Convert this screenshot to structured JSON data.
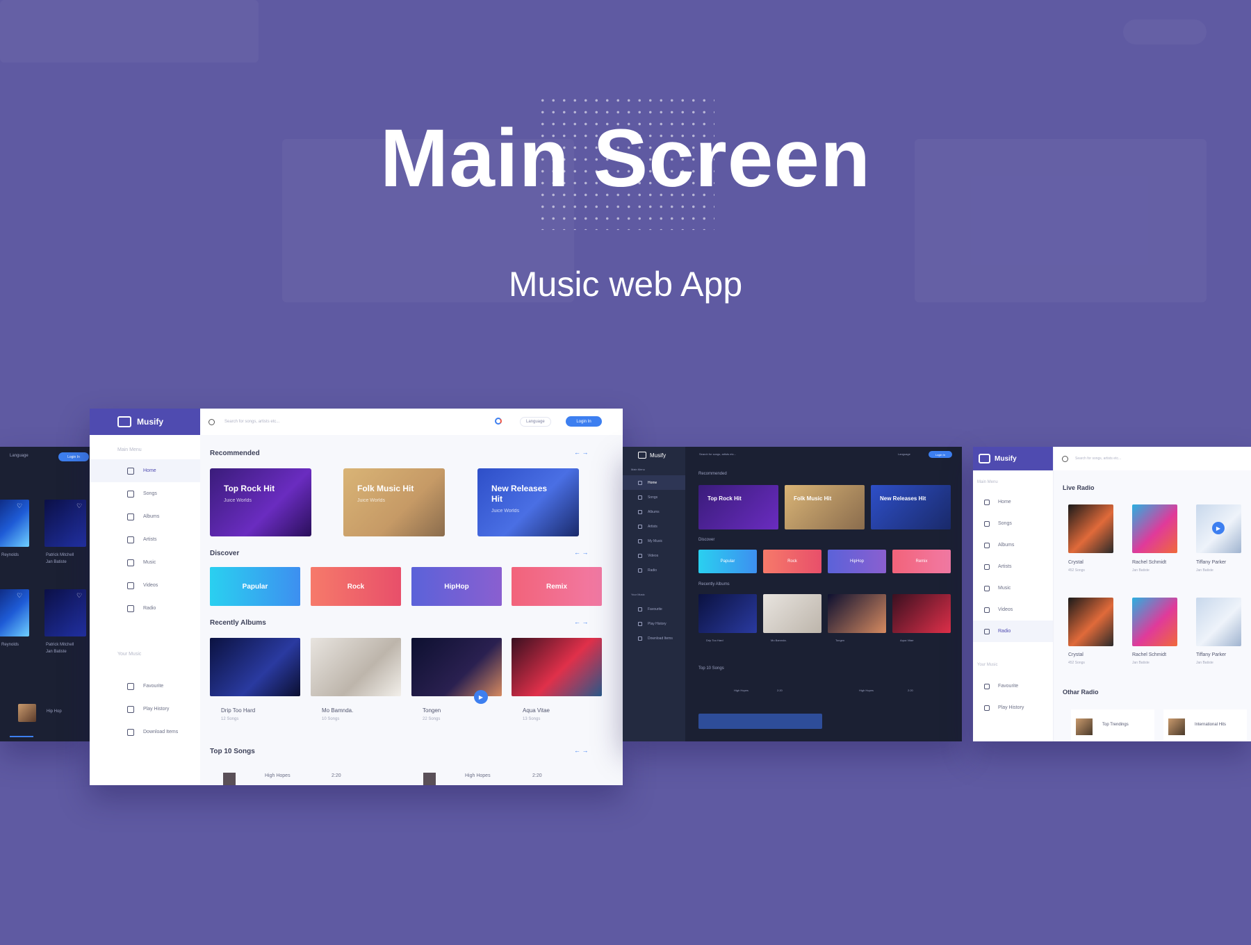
{
  "hero": {
    "title": "Main Screen",
    "subtitle": "Music web App"
  },
  "app": {
    "brand": "Musify"
  },
  "topbar": {
    "search_placeholder": "Search for songs, artists etc...",
    "language": "Language",
    "login": "Login In"
  },
  "sidebar": {
    "main_menu_label": "Main Menu",
    "items": [
      "Home",
      "Songs",
      "Albums",
      "Artists",
      "Music",
      "Videos",
      "Radio"
    ],
    "your_music_label": "Your Music",
    "your_items": [
      "Favourite",
      "Play History",
      "Download Items"
    ]
  },
  "sections": {
    "recommended": "Recommended",
    "discover": "Discover",
    "recent": "Recently Albums",
    "top10": "Top 10 Songs"
  },
  "recommended": [
    {
      "title": "Top Rock Hit",
      "sub": "Juice Worlds"
    },
    {
      "title": "Folk Music Hit",
      "sub": "Juice Worlds"
    },
    {
      "title": "New Releases Hit",
      "sub": "Juice Worlds"
    }
  ],
  "genres": [
    "Papular",
    "Rock",
    "HipHop",
    "Remix"
  ],
  "albums": [
    {
      "title": "Drip Too Hard",
      "sub": "12 Songs"
    },
    {
      "title": "Mo Bamnda.",
      "sub": "10 Songs"
    },
    {
      "title": "Tongen",
      "sub": "22 Songs"
    },
    {
      "title": "Aqua Vitae",
      "sub": "13 Songs"
    }
  ],
  "songs": [
    {
      "title": "High Hopes",
      "time": "2:20"
    },
    {
      "title": "High Hopes",
      "time": "2:20"
    }
  ],
  "dark": {
    "my_music": "My Music"
  },
  "radio": {
    "live": "Live Radio",
    "other": "Othar Radio",
    "tiles": [
      {
        "name": "Crystal",
        "sub": "452 Songs"
      },
      {
        "name": "Rachel Schmidt",
        "sub": "Jan Batiste"
      },
      {
        "name": "Tiffany Parker",
        "sub": "Jan Batiste"
      },
      {
        "name": "Crystal",
        "sub": "452 Songs"
      },
      {
        "name": "Rachel Schmidt",
        "sub": "Jan Batiste"
      },
      {
        "name": "Tiffany Parker",
        "sub": "Jan Batiste"
      }
    ],
    "other_items": [
      "Top Trendings",
      "International Hits"
    ]
  },
  "left": {
    "names": [
      "Reynolds",
      "Patrick Mitchell",
      "Reynolds",
      "Patrick Mitchell"
    ],
    "sub": "Jan Batiste",
    "now_playing": "Hip Hop"
  }
}
